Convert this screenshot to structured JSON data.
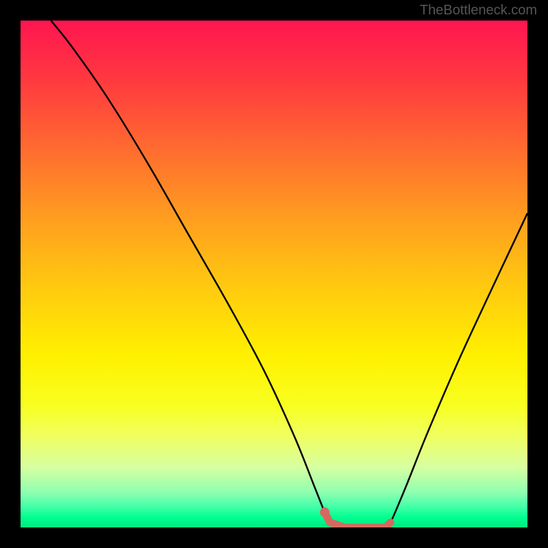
{
  "watermark": "TheBottleneck.com",
  "chart_data": {
    "type": "line",
    "title": "",
    "xlabel": "",
    "ylabel": "",
    "ylim": [
      0,
      100
    ],
    "xlim": [
      0,
      100
    ],
    "series": [
      {
        "name": "bottleneck-curve",
        "x": [
          6,
          10,
          17,
          25,
          33,
          41,
          48,
          54,
          58,
          60,
          61,
          64,
          68,
          72,
          73,
          76,
          80,
          86,
          92,
          100
        ],
        "y": [
          100,
          95,
          85,
          72,
          58,
          44,
          31,
          18,
          8,
          3,
          1,
          0,
          0,
          0,
          1,
          8,
          18,
          32,
          45,
          62
        ]
      },
      {
        "name": "optimal-segment",
        "x": [
          60,
          61,
          64,
          68,
          72,
          73
        ],
        "y": [
          3,
          1,
          0,
          0,
          0,
          1
        ]
      }
    ],
    "gradient": {
      "top": "#ff1550",
      "mid": "#fff000",
      "bottom": "#00ff90"
    },
    "curve_color": "#000000",
    "marker_color": "#d46a5f"
  }
}
